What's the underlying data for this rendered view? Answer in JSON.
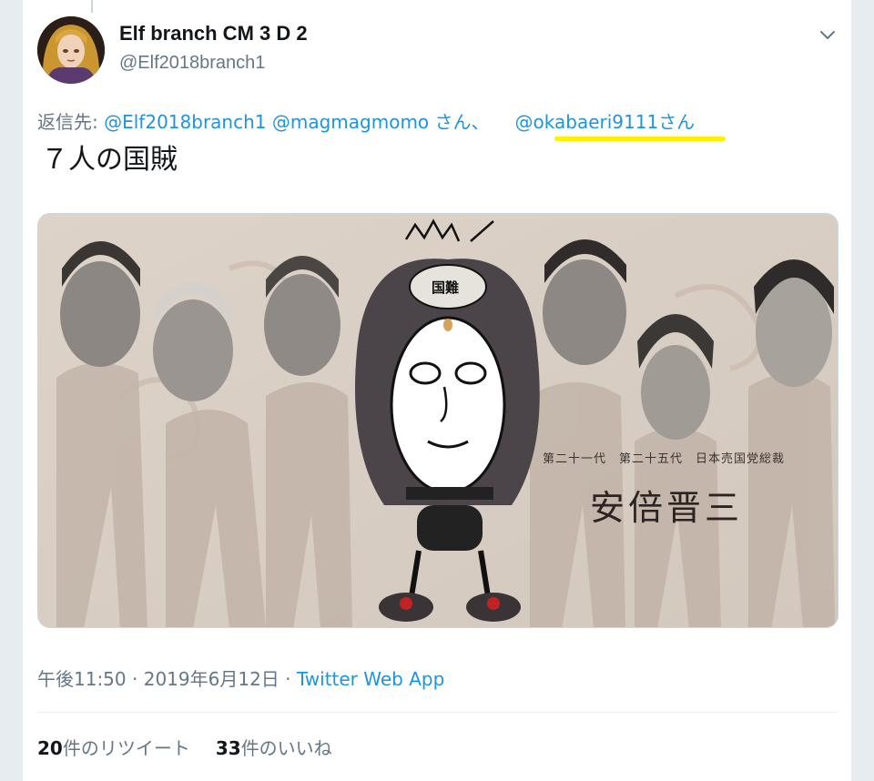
{
  "tweet": {
    "author": {
      "display_name": "Elf branch CM 3 D 2",
      "handle": "@Elf2018branch1"
    },
    "reply_to": {
      "prefix": "返信先: ",
      "mentions": [
        "@Elf2018branch1",
        "@magmagmomo",
        "@okabaeri9111"
      ],
      "san_1": " さん、",
      "san_2": "さん"
    },
    "text": "７人の国賊",
    "media": {
      "crown_label": "国難",
      "caption_small": "第二十一代　第二十五代　日本売国党総裁",
      "caption_big": "安倍晋三"
    },
    "time": "午後11:50",
    "separator": " · ",
    "date": "2019年6月12日",
    "source": "Twitter Web App",
    "retweets": {
      "count": "20",
      "label": "件のリツイート"
    },
    "likes": {
      "count": "33",
      "label": "件のいいね"
    }
  },
  "colors": {
    "link": "#1b95e0",
    "secondary_text": "#657786",
    "highlight": "#fff200"
  },
  "icons": [
    "chevron-down-icon",
    "avatar"
  ]
}
